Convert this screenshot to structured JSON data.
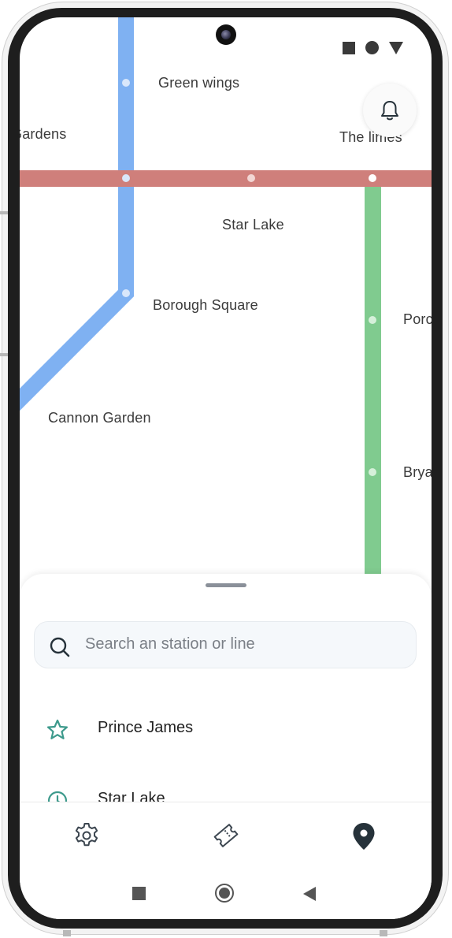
{
  "map": {
    "stations": [
      {
        "id": "green-wings",
        "name": "Green wings"
      },
      {
        "id": "gardens",
        "name": "Gardens"
      },
      {
        "id": "the-limes",
        "name": "The limes"
      },
      {
        "id": "star-lake",
        "name": "Star Lake"
      },
      {
        "id": "borough-square",
        "name": "Borough Square"
      },
      {
        "id": "cannon-garden",
        "name": "Cannon Garden"
      },
      {
        "id": "porc",
        "name": "Porc"
      },
      {
        "id": "brya",
        "name": "Brya"
      }
    ],
    "line_colors": {
      "blue": "#7fb1f2",
      "red": "#cf7f7b",
      "green": "#80cb8f"
    }
  },
  "header": {
    "notification_icon": "bell-icon"
  },
  "search": {
    "placeholder": "Search an station or line",
    "icon": "search-icon"
  },
  "list": [
    {
      "icon": "star-icon",
      "label": "Prince James"
    },
    {
      "icon": "clock-icon",
      "label": "Star Lake"
    }
  ],
  "bottom_nav": [
    {
      "icon": "settings-icon",
      "active": false
    },
    {
      "icon": "ticket-icon",
      "active": false
    },
    {
      "icon": "location-pin-icon",
      "active": true
    }
  ],
  "colors": {
    "accent": "#3d9a8c",
    "icon_dark": "#26323a"
  }
}
